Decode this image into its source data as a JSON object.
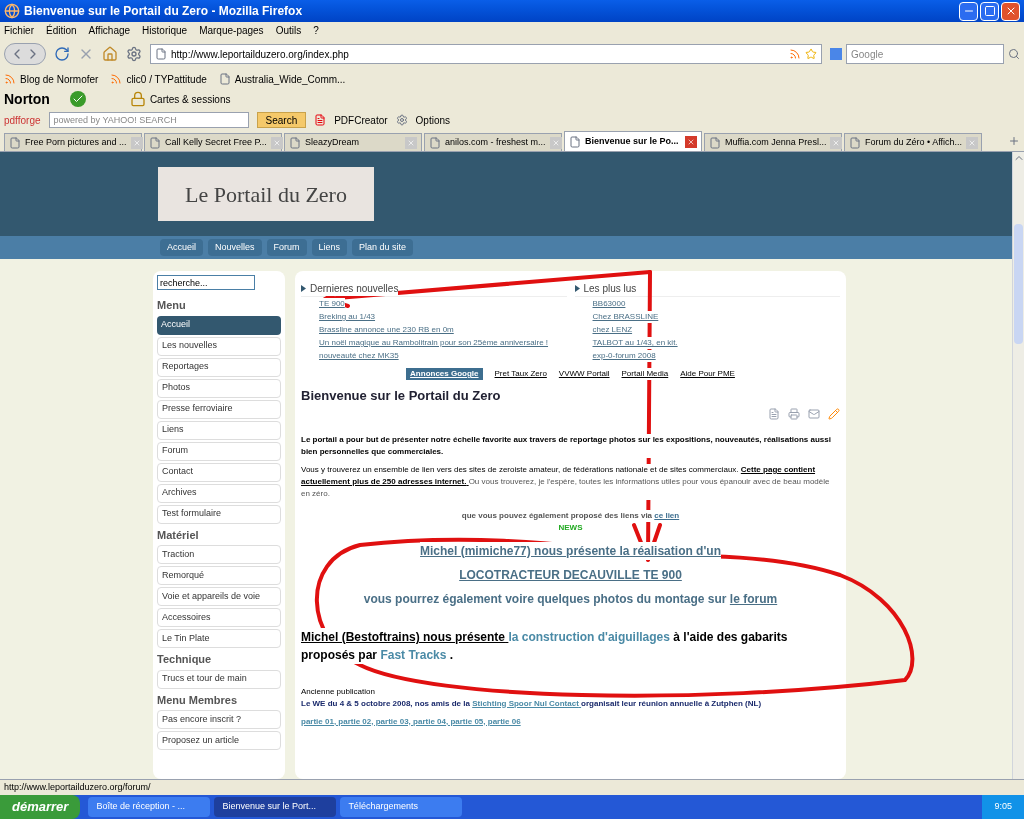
{
  "window": {
    "title": "Bienvenue sur le Portail du Zero - Mozilla Firefox"
  },
  "menu_bar": [
    "Fichier",
    "Édition",
    "Affichage",
    "Historique",
    "Marque-pages",
    "Outils",
    "?"
  ],
  "address_bar": {
    "url": "http://www.leportailduzero.org/index.php"
  },
  "search_bar": {
    "placeholder": "Google"
  },
  "bookmarks": [
    {
      "label": "Blog de Normofer",
      "kind": "feed"
    },
    {
      "label": "clic0 / TYPattitude",
      "kind": "feed"
    },
    {
      "label": "Australia_Wide_Comm...",
      "kind": "page"
    }
  ],
  "norton_bar": {
    "brand": "Norton",
    "item": "Cartes & sessions"
  },
  "pdf_bar": {
    "brand": "pdfforge",
    "search_placeholder": "powered by YAHOO! SEARCH",
    "search_button": "Search",
    "creator": "PDFCreator",
    "options": "Options"
  },
  "tabs": [
    {
      "label": "Free Porn pictures and ...",
      "selected": false
    },
    {
      "label": "Call Kelly Secret Free P...",
      "selected": false
    },
    {
      "label": "SleazyDream",
      "selected": false
    },
    {
      "label": "anilos.com - freshest m...",
      "selected": false
    },
    {
      "label": "Bienvenue sur le Po...",
      "selected": true
    },
    {
      "label": "Muffia.com Jenna Presl...",
      "selected": false
    },
    {
      "label": "Forum du Zéro • Affich...",
      "selected": false
    }
  ],
  "page": {
    "logo": "Le Portail du Zero",
    "nav": [
      "Accueil",
      "Nouvelles",
      "Forum",
      "Liens",
      "Plan du site"
    ],
    "sidebar": {
      "search_value": "recherche...",
      "sections": [
        {
          "heading": "Menu",
          "items": [
            {
              "label": "Accueil",
              "selected": true
            },
            {
              "label": "Les nouvelles",
              "selected": false
            },
            {
              "label": "Reportages",
              "selected": false
            },
            {
              "label": "Photos",
              "selected": false
            },
            {
              "label": "Presse ferroviaire",
              "selected": false
            },
            {
              "label": "Liens",
              "selected": false
            },
            {
              "label": "Forum",
              "selected": false
            },
            {
              "label": "Contact",
              "selected": false
            },
            {
              "label": "Archives",
              "selected": false
            },
            {
              "label": "Test formulaire",
              "selected": false
            }
          ]
        },
        {
          "heading": "Matériel",
          "items": [
            {
              "label": "Traction",
              "selected": false
            },
            {
              "label": "Remorqué",
              "selected": false
            },
            {
              "label": "Voie et appareils de voie",
              "selected": false
            },
            {
              "label": "Accessoires",
              "selected": false
            },
            {
              "label": "Le Tin Plate",
              "selected": false
            }
          ]
        },
        {
          "heading": "Technique",
          "items": [
            {
              "label": "Trucs et tour de main",
              "selected": false
            }
          ]
        },
        {
          "heading": "Menu Membres",
          "items": [
            {
              "label": "Pas encore inscrit ?",
              "selected": false
            },
            {
              "label": "Proposez un article",
              "selected": false
            }
          ]
        }
      ]
    },
    "news_columns": [
      {
        "heading": "Dernieres nouvelles",
        "items": [
          "TE 900",
          "Breking au 1/43",
          "Brassline annonce une 230 RB en 0m",
          "Un noël magique au Rambolitrain pour son 25ème anniversaire !",
          "nouveauté chez MK35"
        ]
      },
      {
        "heading": "Les plus lus",
        "items": [
          "BB63000",
          "Chez BRASSLINE",
          "chez LENZ",
          "TALBOT au 1/43, en kit.",
          "exp-0-forum 2008"
        ]
      }
    ],
    "ads": [
      {
        "label": "Annonces Google",
        "selected": true
      },
      {
        "label": "Pret Taux Zero",
        "selected": false
      },
      {
        "label": "VVWW Portail",
        "selected": false
      },
      {
        "label": "Portail Media",
        "selected": false
      },
      {
        "label": "Aide Pour PME",
        "selected": false
      }
    ],
    "title": "Bienvenue sur le Portail du Zero",
    "intro": "Le portail a pour but de présenter notre échelle favorite aux travers de reportage photos sur les expositions, nouveautés, réalisations aussi bien personnelles que commerciales.",
    "paragraph": [
      {
        "text": "Vous y trouverez un ensemble de lien vers des sites de zeroiste amateur, de fédérations nationale et de sites commerciaux.",
        "kind": "plain"
      },
      {
        "text": "Cette page contient actuellement plus de 250 adresses internet.",
        "kind": "strong"
      },
      {
        "text": "Ou vous trouverez, je l'espère, toutes les informations utiles pour vous épanouir avec de beau modèle en zéro.",
        "kind": "muted"
      }
    ],
    "suggest": {
      "text": "que vous pouvez également proposé des liens via",
      "link": "ce lien"
    },
    "news_tag": "NEWS",
    "featured": [
      {
        "text": "Michel (mimiche77) nous présente la réalisation d'un",
        "kind": "link"
      },
      {
        "text": "LOCOTRACTEUR DECAUVILLE TE 900",
        "kind": "link"
      },
      {
        "text": "vous pourrez également voire quelques photos du montage sur",
        "kind": "plain",
        "link": "le forum"
      }
    ],
    "bestof": [
      {
        "text": "Michel (Bestoftrains) nous présente",
        "kind": "underline"
      },
      {
        "text": "la construction d'aiguillages",
        "kind": "link"
      },
      {
        "text": "à l'aide des gabarits proposés par",
        "kind": "plain"
      },
      {
        "text": "Fast Tracks",
        "kind": "link"
      },
      {
        "text": ".",
        "kind": "plain"
      }
    ],
    "archive_label": "Ancienne publication",
    "archive": [
      {
        "text": "Le WE du 4 & 5 octobre 2008, nos amis de la",
        "kind": "plain"
      },
      {
        "text": "Stichting Spoor Nul Contact",
        "kind": "link"
      },
      {
        "text": "organisait leur réunion annuelle à Zutphen (NL)",
        "kind": "plain"
      }
    ],
    "parts": "partie 01, partie 02, partie 03, partie 04, partie 05, partie 06"
  },
  "status_bar": "http://www.leportailduzero.org/forum/",
  "taskbar": {
    "start": "démarrer",
    "tasks": [
      {
        "label": "Boîte de réception - ...",
        "selected": false
      },
      {
        "label": "Bienvenue sur le Port...",
        "selected": true
      },
      {
        "label": "Téléchargements",
        "selected": false
      }
    ],
    "clock": "9:05"
  }
}
